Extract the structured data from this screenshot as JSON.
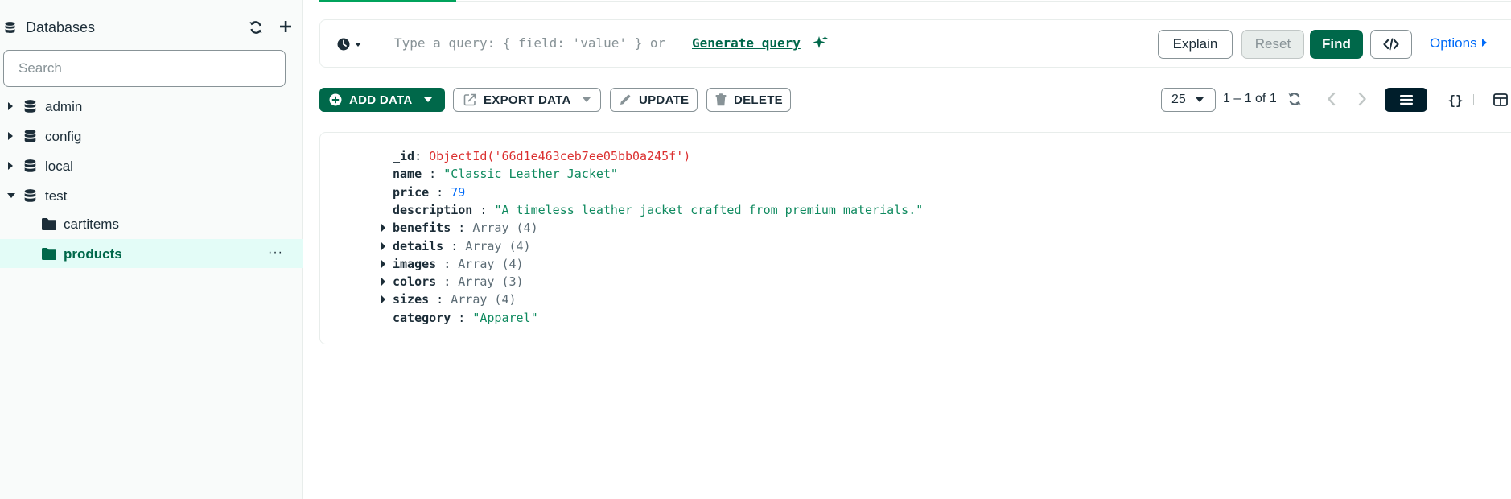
{
  "sidebar": {
    "title": "Databases",
    "search_placeholder": "Search",
    "databases": [
      {
        "name": "admin",
        "expanded": false
      },
      {
        "name": "config",
        "expanded": false
      },
      {
        "name": "local",
        "expanded": false
      },
      {
        "name": "test",
        "expanded": true
      }
    ],
    "collections": [
      {
        "name": "cartitems",
        "active": false
      },
      {
        "name": "products",
        "active": true
      }
    ],
    "more_label": "···"
  },
  "query": {
    "placeholder": "Type a query: { field: 'value' } or",
    "generate_link": "Generate query",
    "explain_label": "Explain",
    "reset_label": "Reset",
    "find_label": "Find",
    "options_label": "Options"
  },
  "toolbar": {
    "add_data": "ADD DATA",
    "export_data": "EXPORT DATA",
    "update": "UPDATE",
    "delete": "DELETE",
    "page_size": "25",
    "range": "1 – 1 of 1",
    "json_view_glyph": "{}"
  },
  "document": {
    "fields": [
      {
        "key": "_id",
        "sep": ": ",
        "value": "ObjectId('66d1e463ceb7ee05bb0a245f')",
        "type": "oid",
        "expandable": false
      },
      {
        "key": "name",
        "sep": " : ",
        "value": "\"Classic Leather Jacket\"",
        "type": "str",
        "expandable": false
      },
      {
        "key": "price",
        "sep": " : ",
        "value": "79",
        "type": "num",
        "expandable": false
      },
      {
        "key": "description",
        "sep": " : ",
        "value": "\"A timeless leather jacket crafted from premium materials.\"",
        "type": "str",
        "expandable": false
      },
      {
        "key": "benefits",
        "sep": " : ",
        "value": "Array (4)",
        "type": "arr",
        "expandable": true
      },
      {
        "key": "details",
        "sep": " : ",
        "value": "Array (4)",
        "type": "arr",
        "expandable": true
      },
      {
        "key": "images",
        "sep": " : ",
        "value": "Array (4)",
        "type": "arr",
        "expandable": true
      },
      {
        "key": "colors",
        "sep": " : ",
        "value": "Array (3)",
        "type": "arr",
        "expandable": true
      },
      {
        "key": "sizes",
        "sep": " : ",
        "value": "Array (4)",
        "type": "arr",
        "expandable": true
      },
      {
        "key": "category",
        "sep": " : ",
        "value": "\"Apparel\"",
        "type": "str",
        "expandable": false
      }
    ]
  },
  "colors": {
    "brand_green": "#00684a",
    "active_bg": "#e3fcf7",
    "link_blue": "#016bf8",
    "oid_red": "#db3030",
    "string_green": "#0f8a5f"
  }
}
